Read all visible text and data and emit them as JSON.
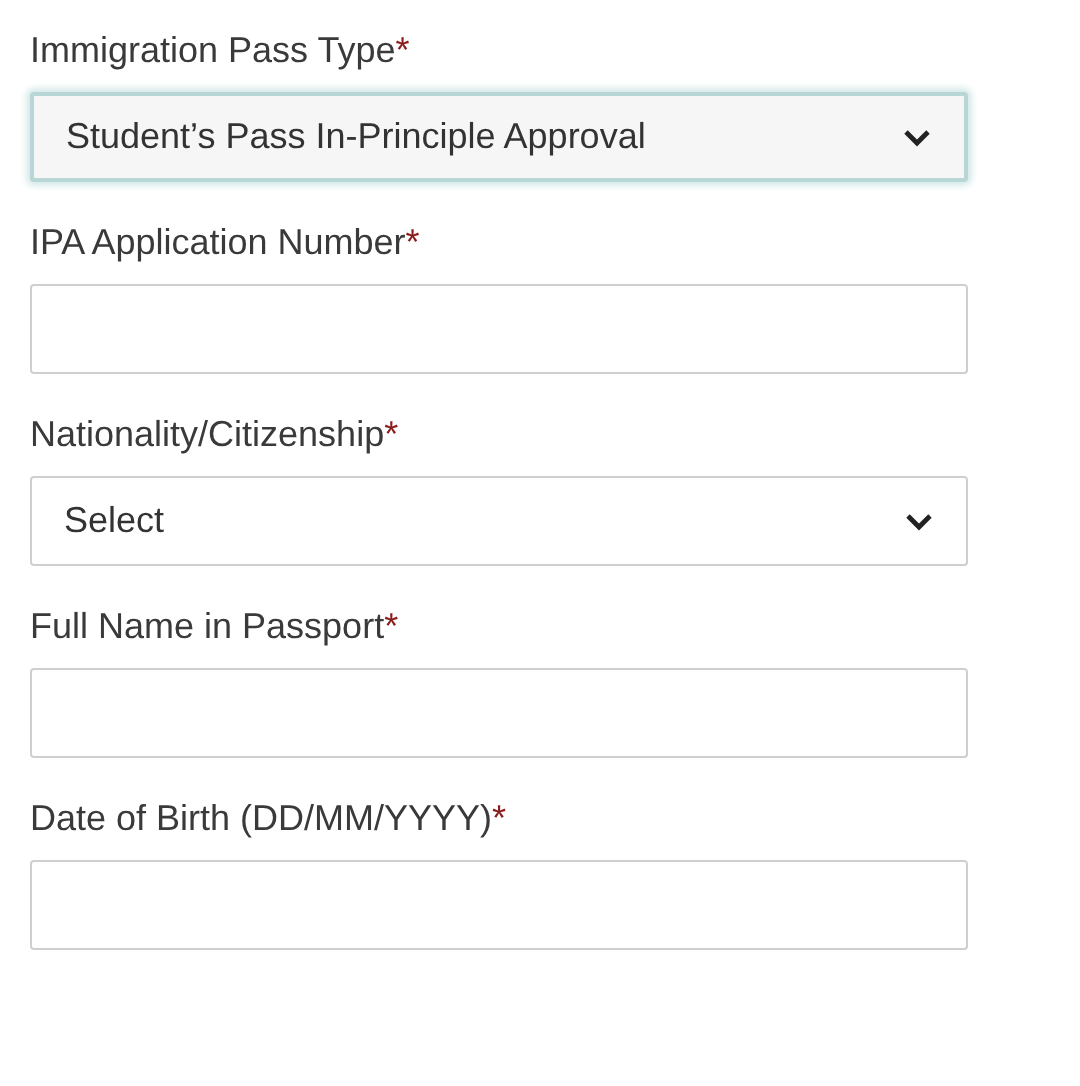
{
  "fields": [
    {
      "label": "Immigration Pass Type",
      "required_mark": "*",
      "kind": "select",
      "value": "Student’s Pass In-Principle Approval",
      "focused": true
    },
    {
      "label": "IPA Application Number",
      "required_mark": "*",
      "kind": "text",
      "focused": false
    },
    {
      "label": "Nationality/Citizenship",
      "required_mark": "*",
      "kind": "select",
      "value": "Select",
      "focused": false
    },
    {
      "label": "Full Name in Passport",
      "required_mark": "*",
      "kind": "text",
      "focused": false
    },
    {
      "label": "Date of Birth (DD/MM/YYYY)",
      "required_mark": "*",
      "kind": "text",
      "focused": false
    }
  ]
}
